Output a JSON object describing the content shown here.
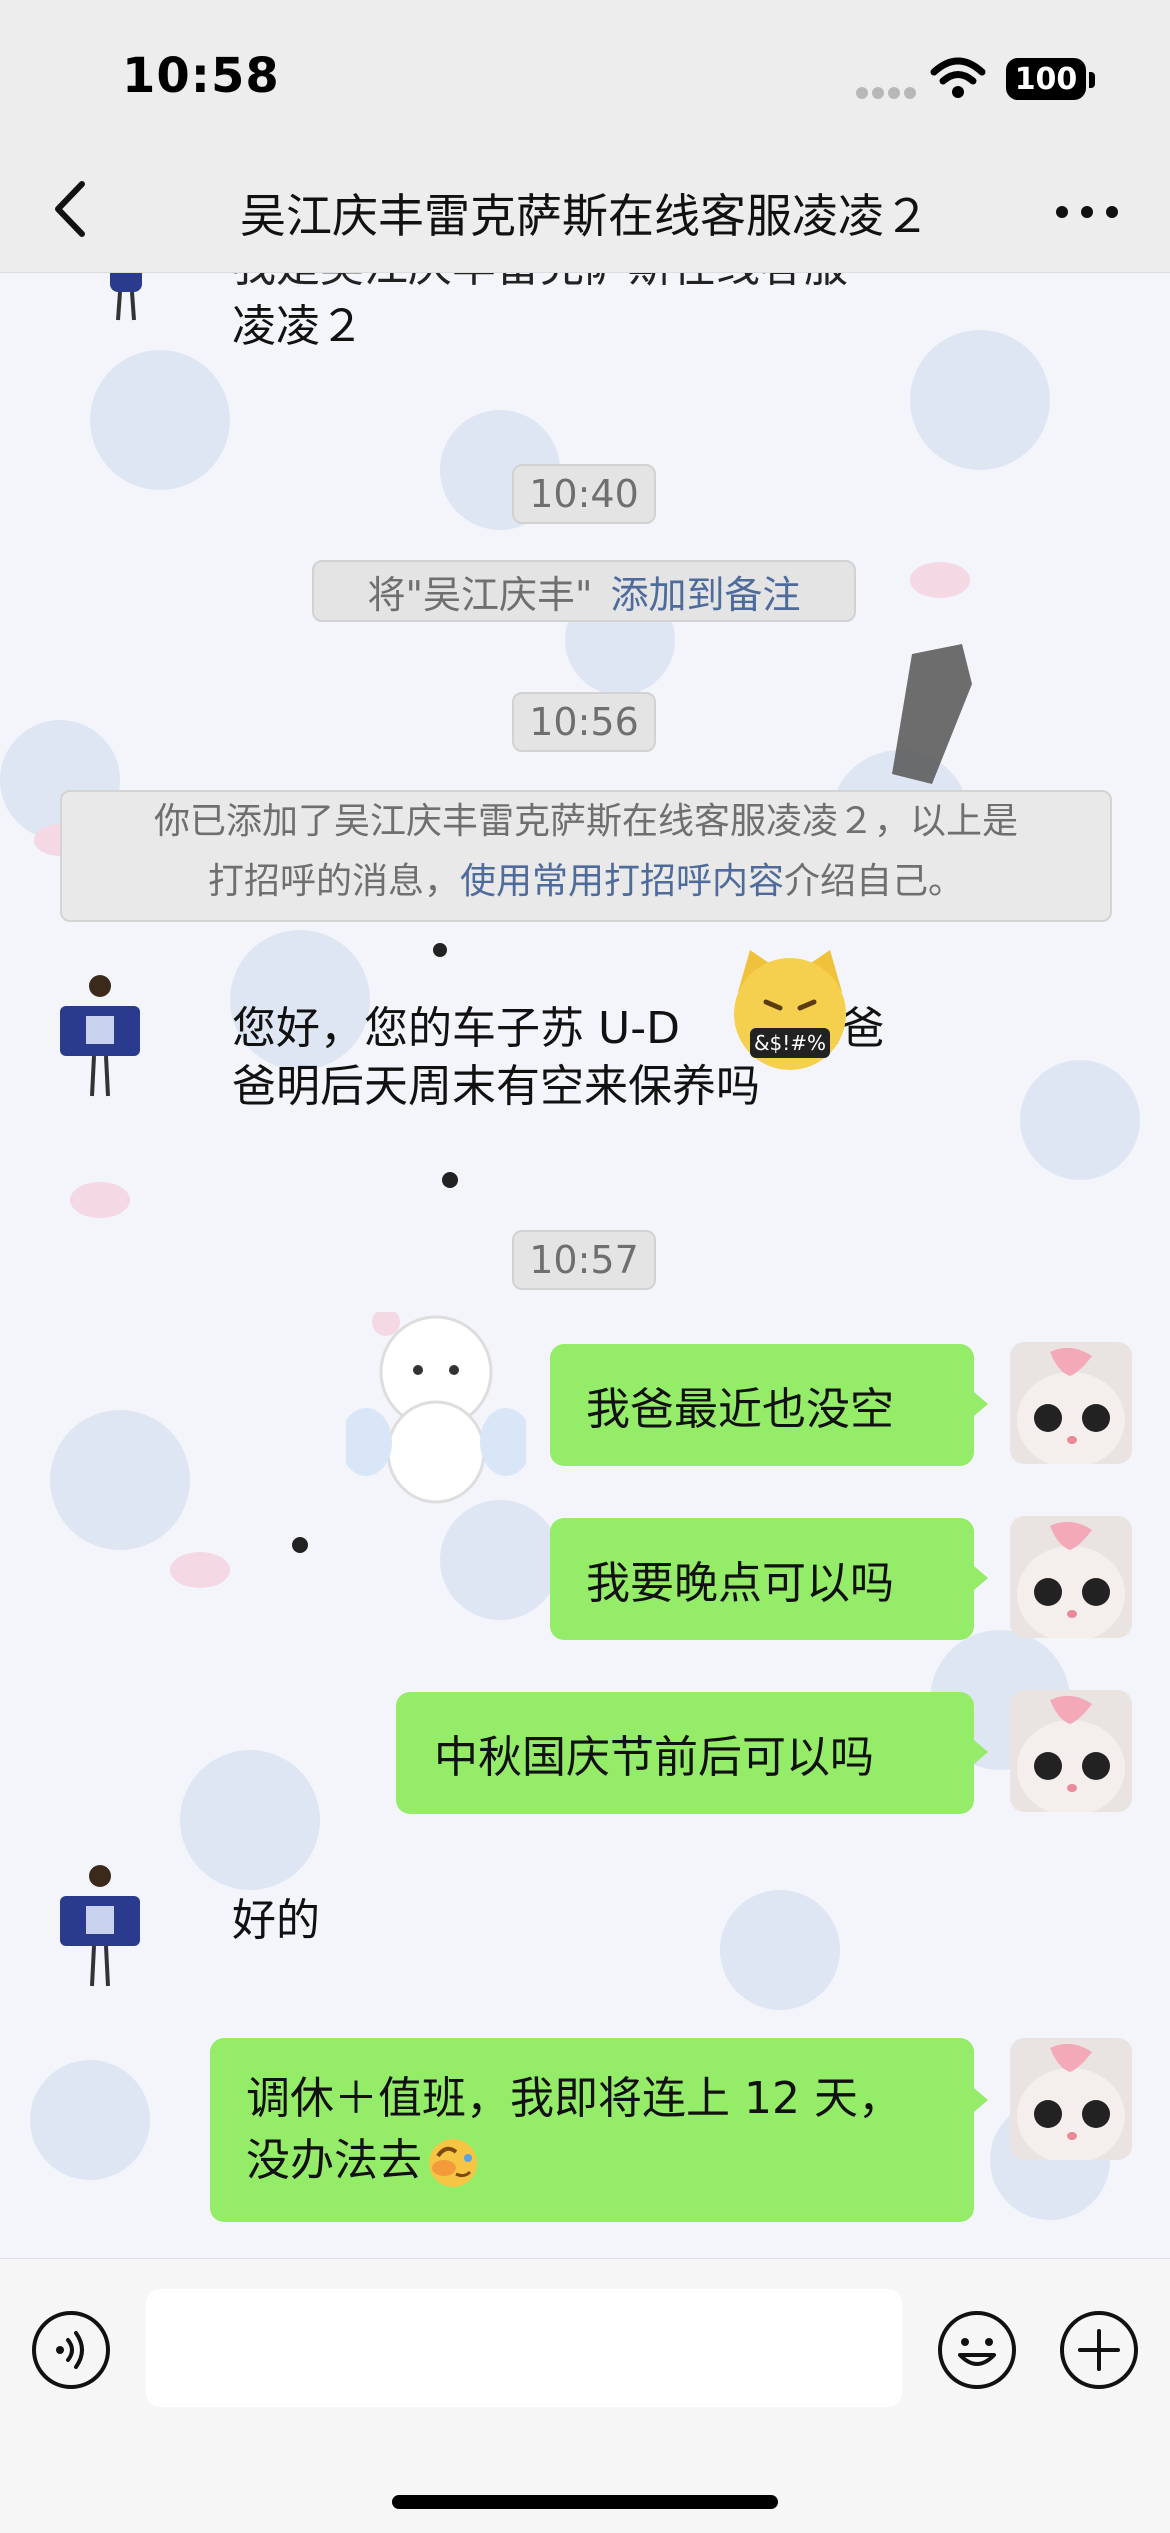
{
  "status": {
    "time": "10:58",
    "battery": "100"
  },
  "nav": {
    "title": "吴江庆丰雷克萨斯在线客服凌凌２"
  },
  "messages": {
    "intro_partial": "我是吴江庆丰雷克萨斯在线客服",
    "intro_end": "凌凌２",
    "t1": "10:40",
    "remark_prefix": "将\"吴江庆丰\"",
    "remark_link": "添加到备注",
    "t2": "10:56",
    "notice_line1": "你已添加了吴江庆丰雷克萨斯在线客服凌凌２，以上是",
    "notice_line2_prefix": "打招呼的消息，",
    "notice_link": "使用常用打招呼内容",
    "notice_line2_suffix": "介绍自己。",
    "agent_msg_line1": "您好，您的车子苏 U-D",
    "agent_msg_tail": "P 您爸",
    "agent_msg_line2": "爸明后天周末有空来保养吗",
    "sticker_text": "&$!#%",
    "t3": "10:57",
    "me1": "我爸最近也没空",
    "me2": "我要晚点可以吗",
    "me3": "中秋国庆节前后可以吗",
    "agent_reply": "好的",
    "me4_line1": "调休＋值班，我即将连上 12 天，",
    "me4_line2": "没办法去"
  },
  "colors": {
    "bubble": "#95ec69",
    "link": "#4e6b9c",
    "bar": "#ededed"
  },
  "icons": [
    "back-icon",
    "more-icon",
    "voice-icon",
    "emoji-icon",
    "plus-icon",
    "wifi-icon",
    "signal-icon"
  ]
}
